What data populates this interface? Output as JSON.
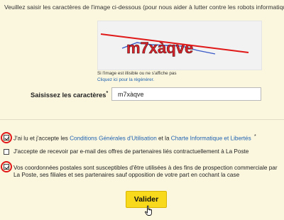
{
  "instructions": "Veuillez saisir les caractères de l'image ci-dessous (pour nous aider à lutter contre les robots informatiques)",
  "captcha": {
    "image_text": "m7xàqve",
    "help_line1": "Si l'image est illisible ou ne s'affiche pas",
    "help_link": "Cliquez ici pour la régénérer."
  },
  "field": {
    "label": "Saisissez les caractères",
    "required_mark": "*",
    "colon": ":",
    "value": "m7xàqve"
  },
  "consents": [
    {
      "checked": true,
      "prefix": "J'ai lu et j'accepte les ",
      "link1": "Conditions Générales d'Utilisation",
      "middle": " et la ",
      "link2": "Charte Informatique et Libertés",
      "required_mark": "*"
    },
    {
      "checked": false,
      "text": "J'accepte de recevoir par e-mail des offres de partenaires liés contractuellement à La Poste"
    },
    {
      "checked": true,
      "line1": "Vos coordonnées postales sont susceptibles d'être utilisées à des fins de prospection commerciale par",
      "line2": "La Poste, ses filiales et ses partenaires sauf opposition de votre part en cochant la case"
    }
  ],
  "submit_label": "Valider",
  "colors": {
    "background": "#fbf7df",
    "link": "#1c5fb0",
    "button": "#f9d91c",
    "highlight_ring": "#e01818"
  }
}
